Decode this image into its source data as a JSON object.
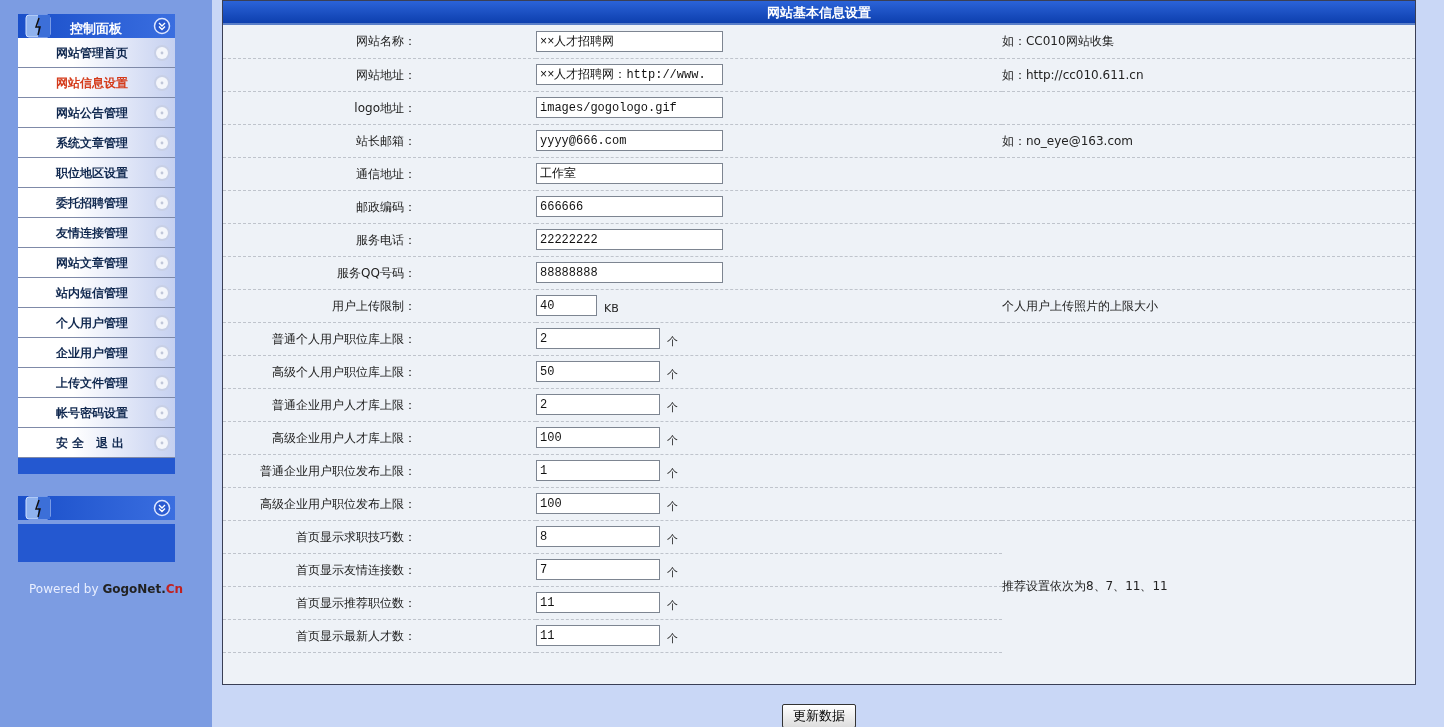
{
  "sidebar": {
    "panels": [
      {
        "kind": "menu",
        "title": "控制面板",
        "items": [
          {
            "label": "网站管理首页",
            "selected": false
          },
          {
            "label": "网站信息设置",
            "selected": true
          },
          {
            "label": "网站公告管理",
            "selected": false
          },
          {
            "label": "系统文章管理",
            "selected": false
          },
          {
            "label": "职位地区设置",
            "selected": false
          },
          {
            "label": "委托招聘管理",
            "selected": false
          },
          {
            "label": "友情连接管理",
            "selected": false
          },
          {
            "label": "网站文章管理",
            "selected": false
          },
          {
            "label": "站内短信管理",
            "selected": false
          },
          {
            "label": "个人用户管理",
            "selected": false
          },
          {
            "label": "企业用户管理",
            "selected": false
          },
          {
            "label": "上传文件管理",
            "selected": false
          },
          {
            "label": "帐号密码设置",
            "selected": false
          },
          {
            "label": "安 全　退 出",
            "selected": false
          }
        ]
      },
      {
        "kind": "blank"
      }
    ],
    "footer": {
      "prefix": "Powered by",
      "brand": "GogoNet.",
      "brand_end": "Cn"
    }
  },
  "form": {
    "title": "网站基本信息设置",
    "fields": [
      {
        "label": "网站名称：",
        "value": "××人才招聘网",
        "kind": "wide",
        "hint": "如：CC010网站收集"
      },
      {
        "label": "网站地址：",
        "value": "××人才招聘网：http://www.",
        "kind": "wide",
        "hint": "如：http://cc010.611.cn"
      },
      {
        "label": "logo地址：",
        "value": "images/gogologo.gif",
        "kind": "wide"
      },
      {
        "label": "站长邮箱：",
        "value": "yyyy@666.com",
        "kind": "wide",
        "hint": "如：no_eye@163.com"
      },
      {
        "label": "通信地址：",
        "value": "工作室",
        "kind": "wide"
      },
      {
        "label": "邮政编码：",
        "value": "666666",
        "kind": "wide"
      },
      {
        "label": "服务电话：",
        "value": "22222222",
        "kind": "wide"
      },
      {
        "label": "服务QQ号码：",
        "value": "88888888",
        "kind": "wide"
      },
      {
        "label": "用户上传限制：",
        "value": "40",
        "kind": "tiny",
        "unit": "KB",
        "hint": "个人用户上传照片的上限大小"
      },
      {
        "label": "普通个人用户职位库上限：",
        "value": "2",
        "kind": "narrow",
        "unit": "个"
      },
      {
        "label": "高级个人用户职位库上限：",
        "value": "50",
        "kind": "narrow",
        "unit": "个"
      },
      {
        "label": "普通企业用户人才库上限：",
        "value": "2",
        "kind": "narrow",
        "unit": "个"
      },
      {
        "label": "高级企业用户人才库上限：",
        "value": "100",
        "kind": "narrow",
        "unit": "个"
      },
      {
        "label": "普通企业用户职位发布上限：",
        "value": "1",
        "kind": "narrow",
        "unit": "个"
      },
      {
        "label": "高级企业用户职位发布上限：",
        "value": "100",
        "kind": "narrow",
        "unit": "个"
      }
    ],
    "homepage_fields": [
      {
        "label": "首页显示求职技巧数：",
        "value": "8",
        "kind": "narrow",
        "unit": "个"
      },
      {
        "label": "首页显示友情连接数：",
        "value": "7",
        "kind": "narrow",
        "unit": "个"
      },
      {
        "label": "首页显示推荐职位数：",
        "value": "11",
        "kind": "narrow",
        "unit": "个"
      },
      {
        "label": "首页显示最新人才数：",
        "value": "11",
        "kind": "narrow",
        "unit": "个"
      }
    ],
    "homepage_hint": "推荐设置依次为8、7、11、11",
    "submit": "更新数据"
  }
}
